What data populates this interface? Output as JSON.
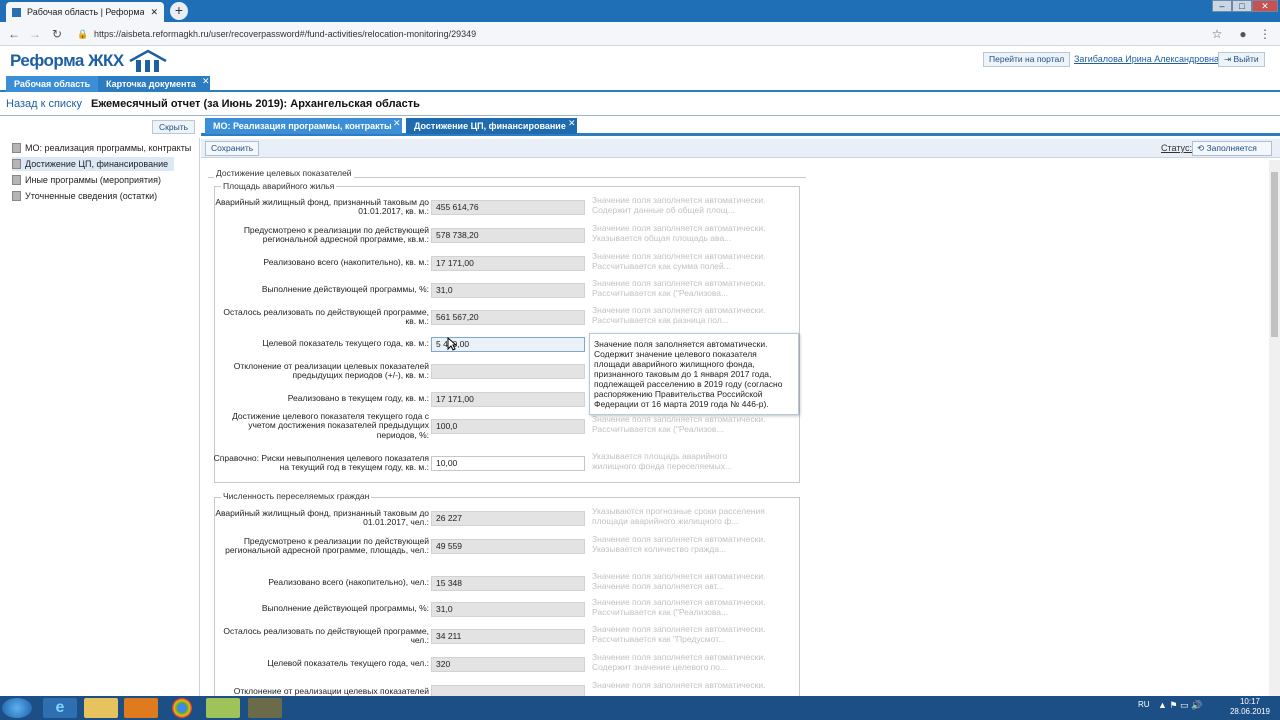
{
  "browser": {
    "tab_title": "Рабочая область | Реформа ЖК",
    "url": "https://aisbeta.reformagkh.ru/user/recoverpassword#/fund-activities/relocation-monitoring/29349"
  },
  "header": {
    "logo_text": "Реформа ЖКХ",
    "portal_button": "Перейти на портал",
    "user_name": "Загибалова Ирина Александровна",
    "logout_button": "Выйти"
  },
  "app_tabs": [
    {
      "label": "Рабочая область"
    },
    {
      "label": "Карточка документа"
    }
  ],
  "page": {
    "back_link": "Назад к списку",
    "title": "Ежемесячный отчет (за Июнь 2019): Архангельская область"
  },
  "sidebar": {
    "hide_button": "Скрыть",
    "items": [
      {
        "label": "МО: реализация программы, контракты"
      },
      {
        "label": "Достижение ЦП, финансирование"
      },
      {
        "label": "Иные программы (мероприятия)"
      },
      {
        "label": "Уточненные сведения (остатки)"
      }
    ]
  },
  "content_tabs": [
    {
      "label": "МО: Реализация программы, контракты"
    },
    {
      "label": "Достижение ЦП, финансирование"
    }
  ],
  "toolbar": {
    "save_button": "Сохранить",
    "status_label": "Статус:",
    "status_value": "Заполняется"
  },
  "form": {
    "outer_legend": "Достижение целевых показателей",
    "section1": {
      "legend": "Площадь аварийного жилья",
      "rows": [
        {
          "label": "Аварийный жилищный фонд, признанный таковым до 01.01.2017, кв. м.:",
          "value": "455 614,76",
          "hint1": "Значение поля заполняется автоматически.",
          "hint2": "Содержит данные об общей площ..."
        },
        {
          "label": "Предусмотрено к реализации по действующей региональной адресной программе, кв.м.:",
          "value": "578 738,20",
          "hint1": "Значение поля заполняется автоматически.",
          "hint2": "Указывается общая площадь ава..."
        },
        {
          "label": "Реализовано всего (накопительно), кв. м.:",
          "value": "17 171,00",
          "hint1": "Значение поля заполняется автоматически.",
          "hint2": "Рассчитывается как сумма полей..."
        },
        {
          "label": "Выполнение действующей программы, %:",
          "value": "31,0",
          "hint1": "Значение поля заполняется автоматически.",
          "hint2": "Рассчитывается как (\"Реализова..."
        },
        {
          "label": "Осталось реализовать по действующей программе, кв. м.:",
          "value": "561 567,20",
          "hint1": "Значение поля заполняется автоматически.",
          "hint2": "Рассчитывается как разница пол..."
        },
        {
          "label": "Целевой показатель текущего года, кв. м.:",
          "value": "5 400,00",
          "hint1": "",
          "hint2": ""
        },
        {
          "label": "Отклонение от реализации целевых показателей предыдущих периодов (+/-), кв. м.:",
          "value": "",
          "hint1": "",
          "hint2": ""
        },
        {
          "label": "Реализовано в текущем году, кв. м.:",
          "value": "17 171,00",
          "hint1": "",
          "hint2": ""
        },
        {
          "label": "Достижение целевого показателя текущего года с учетом достижения показателей предыдущих периодов, %:",
          "value": "100,0",
          "hint1": "Значение поля заполняется автоматически.",
          "hint2": "Рассчитывается как (\"Реализов..."
        },
        {
          "label": "Справочно: Риски невыполнения целевого показателя на текущий год в текущем году, кв. м.:",
          "value": "10,00",
          "hint1": "Указывается площадь аварийного",
          "hint2": "жилищного фонда переселяемых..."
        }
      ]
    },
    "section2": {
      "legend": "Численность переселяемых граждан",
      "rows": [
        {
          "label": "Аварийный жилищный фонд, признанный таковым до 01.01.2017, чел.:",
          "value": "26 227",
          "hint1": "Указываются прогнозные сроки расселения",
          "hint2": "площади аварийного жилищного ф..."
        },
        {
          "label": "Предусмотрено к реализации по действующей региональной адресной программе, площадь, чел.:",
          "value": "49 559",
          "hint1": "Значение поля заполняется автоматически.",
          "hint2": "Указывается количество гражда..."
        },
        {
          "label": "Реализовано всего (накопительно), чел.:",
          "value": "15 348",
          "hint1": "Значение поля заполняется автоматически.",
          "hint2": "Значение поля заполняется авт..."
        },
        {
          "label": "Выполнение действующей программы, %:",
          "value": "31,0",
          "hint1": "Значение поля заполняется автоматически.",
          "hint2": "Рассчитывается как (\"Реализова..."
        },
        {
          "label": "Осталось реализовать по действующей программе, чел.:",
          "value": "34 211",
          "hint1": "Значение поля заполняется автоматически.",
          "hint2": "Рассчитывается как \"Предусмот..."
        },
        {
          "label": "Целевой показатель текущего года, чел.:",
          "value": "320",
          "hint1": "Значение поля заполняется автоматически.",
          "hint2": "Содержит значение целевого по..."
        },
        {
          "label": "Отклонение от реализации целевых показателей",
          "value": "",
          "hint1": "Значение поля заполняется автоматически.",
          "hint2": ""
        }
      ]
    },
    "tooltip": "Значение поля заполняется автоматически. Содержит значение целевого показателя площади аварийного жилищного фонда, признанного таковым до 1 января 2017 года, подлежащей расселению в 2019 году (согласно распоряжению Правительства Российской Федерации от 16 марта 2019 года № 446-р)."
  },
  "taskbar": {
    "lang": "RU",
    "time": "10:17",
    "date": "28.06.2019"
  }
}
